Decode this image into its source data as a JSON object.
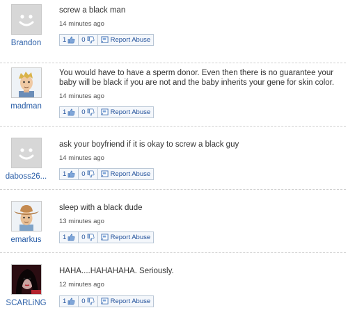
{
  "answers": [
    {
      "user": "Brandon",
      "avatar_icon": "default-avatar-icon",
      "text": "screw a black man",
      "time": "14 minutes ago",
      "thumbs_up": "1",
      "thumbs_down": "0",
      "report": "Report Abuse"
    },
    {
      "user": "madman",
      "avatar_icon": "blond-man-avatar-icon",
      "text": "You would have to have a sperm donor. Even then there is no guarantee your baby will be black if you are not and the baby inherits your gene for skin color.",
      "time": "14 minutes ago",
      "thumbs_up": "1",
      "thumbs_down": "0",
      "report": "Report Abuse"
    },
    {
      "user": "daboss26...",
      "avatar_icon": "default-avatar-icon",
      "text": "ask your boyfriend if it is okay to screw a black guy",
      "time": "14 minutes ago",
      "thumbs_up": "1",
      "thumbs_down": "0",
      "report": "Report Abuse"
    },
    {
      "user": "emarkus",
      "avatar_icon": "cowboy-avatar-icon",
      "text": "sleep with a black dude",
      "time": "13 minutes ago",
      "thumbs_up": "1",
      "thumbs_down": "0",
      "report": "Report Abuse"
    },
    {
      "user": "SCARLiNG",
      "avatar_icon": "photo-avatar-icon",
      "text": "HAHA....HAHAHAHA.  Seriously.",
      "time": "12 minutes ago",
      "thumbs_up": "1",
      "thumbs_down": "0",
      "report": "Report Abuse"
    }
  ],
  "colors": {
    "username": "#2b5fa8",
    "button_border": "#b9c7d6",
    "button_bg": "#f4f7fb",
    "separator": "#cfcfcf"
  }
}
